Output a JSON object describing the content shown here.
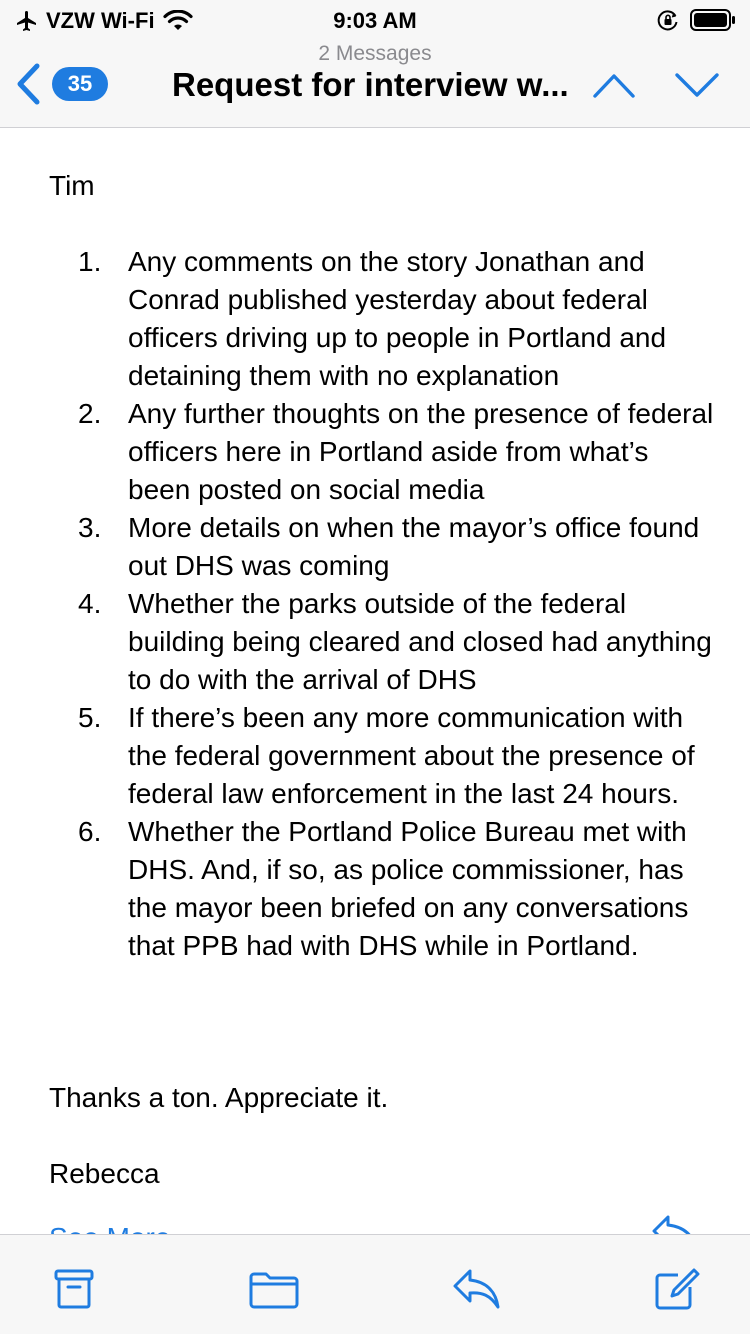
{
  "status_bar": {
    "carrier": "VZW Wi-Fi",
    "time": "9:03 AM"
  },
  "header": {
    "back_count": "35",
    "message_count": "2 Messages",
    "subject": "Request for interview w..."
  },
  "email": {
    "greeting": "Tim",
    "items": [
      {
        "num": "1.",
        "text": "Any comments on the story Jonathan and Conrad published yesterday about federal officers driving up to people in Portland and detaining them with no explanation"
      },
      {
        "num": "2.",
        "text": "Any further thoughts on the presence of federal officers here in Portland aside from what’s been posted on social media"
      },
      {
        "num": "3.",
        "text": "More details on when the mayor’s office found out DHS was coming"
      },
      {
        "num": "4.",
        "text": "Whether the parks outside of the federal building being cleared and closed had anything to do with the arrival of DHS"
      },
      {
        "num": "5.",
        "text": "If there’s been any more communication with the federal government about the presence of federal law enforcement in the last 24 hours."
      },
      {
        "num": "6.",
        "text": "Whether the Portland Police Bureau met with DHS. And, if so, as police commissioner, has the mayor been briefed on any conversations that PPB had with DHS while in Portland."
      }
    ],
    "closing": "Thanks a ton. Appreciate it.",
    "signature": "Rebecca",
    "see_more": "See More"
  },
  "icons": {
    "airplane": "airplane-icon",
    "wifi": "wifi-icon",
    "rotation_lock": "rotation-lock-icon",
    "battery": "battery-icon",
    "back": "chevron-left-icon",
    "prev": "chevron-up-icon",
    "next": "chevron-down-icon",
    "archive": "archive-icon",
    "folder": "folder-icon",
    "reply": "reply-icon",
    "compose": "compose-icon"
  },
  "colors": {
    "accent": "#1f7ce0",
    "bar_background": "#f7f7f7",
    "secondary_text": "#8a8a8e"
  }
}
